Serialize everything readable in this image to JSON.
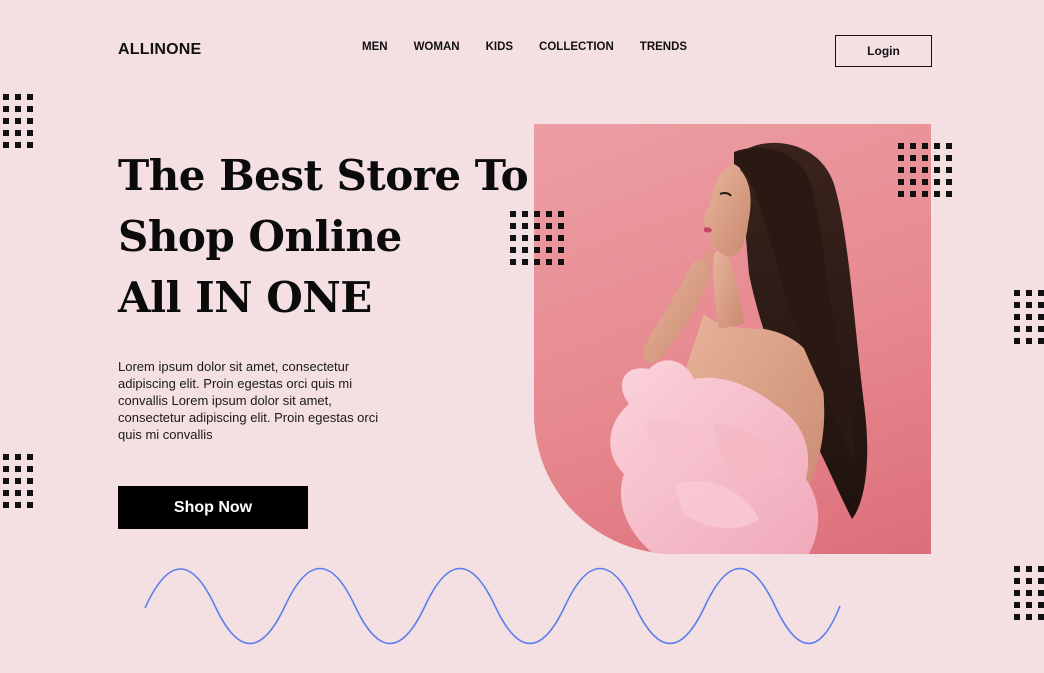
{
  "header": {
    "logo": "ALLINONE",
    "nav": [
      "MEN",
      "WOMAN",
      "KIDS",
      "COLLECTION",
      "TRENDS"
    ],
    "login_label": "Login"
  },
  "hero": {
    "headline_lines": [
      "The Best Store To",
      "Shop Online",
      "All IN ONE"
    ],
    "description": "Lorem ipsum dolor sit amet, consectetur adipiscing elit. Proin egestas orci quis mi convallis Lorem ipsum dolor sit amet, consectetur adipiscing elit. Proin egestas orci quis mi convallis",
    "cta_label": "Shop Now"
  },
  "colors": {
    "background": "#f4dfe2",
    "image_background": "#e7888f",
    "wave": "#5b7df0",
    "text": "#111111"
  },
  "icons": [
    "dot-grid-decoration",
    "wave-decoration"
  ]
}
